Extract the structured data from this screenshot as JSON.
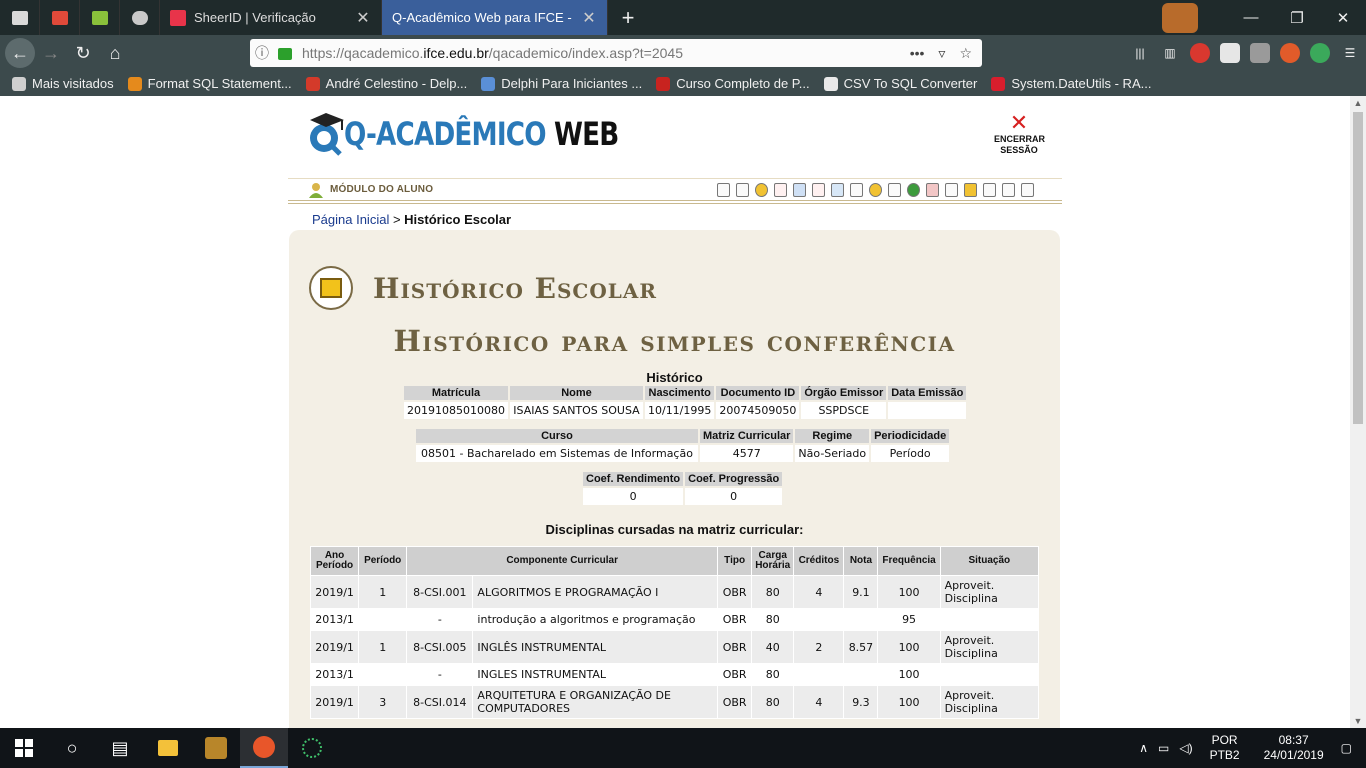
{
  "browser": {
    "tabs": [
      {
        "title": "SheerID | Verificação",
        "close": "✕"
      },
      {
        "title": "Q-Acadêmico Web para IFCE - Hist",
        "close": "✕"
      }
    ],
    "new_tab": "+",
    "url_prefix": "https://qacademico.",
    "url_domain": "ifce.edu.br",
    "url_path": "/qacademico/index.asp?t=2045",
    "bookmarks": [
      {
        "label": "Mais visitados",
        "color": "#cfcfcf"
      },
      {
        "label": "Format SQL Statement...",
        "color": "#e58a1c"
      },
      {
        "label": "André Celestino - Delp...",
        "color": "#d43a2a"
      },
      {
        "label": "Delphi Para Iniciantes ...",
        "color": "#5a8fd6"
      },
      {
        "label": "Curso Completo de P...",
        "color": "#c8231f"
      },
      {
        "label": "CSV To SQL Converter",
        "color": "#e9e9e9"
      },
      {
        "label": "System.DateUtils - RA...",
        "color": "#d81e2d"
      }
    ]
  },
  "header": {
    "logo_part1": "Q-ACADÊMICO",
    "logo_part2": " WEB",
    "logout_line1": "ENCERRAR",
    "logout_line2": "SESSÃO",
    "module_label": "MÓDULO DO ALUNO"
  },
  "breadcrumb": {
    "home": "Página Inicial",
    "separator": " > ",
    "current": "Histórico Escolar"
  },
  "page": {
    "title": "Histórico Escolar",
    "subtitle": "Histórico para simples conferência",
    "section_label": "Histórico",
    "disciplines_label": "Disciplinas cursadas na matriz curricular:"
  },
  "student": {
    "headers": [
      "Matrícula",
      "Nome",
      "Nascimento",
      "Documento ID",
      "Órgão Emissor",
      "Data Emissão"
    ],
    "values": [
      "20191085010080",
      "ISAIAS SANTOS SOUSA",
      "10/11/1995",
      "20074509050",
      "SSPDSCE",
      ""
    ]
  },
  "course": {
    "headers": [
      "Curso",
      "Matriz Curricular",
      "Regime",
      "Periodicidade"
    ],
    "values": [
      "08501 - Bacharelado em Sistemas de Informação",
      "4577",
      "Não-Seriado",
      "Período"
    ]
  },
  "coef": {
    "headers": [
      "Coef. Rendimento",
      "Coef. Progressão"
    ],
    "values": [
      "0",
      "0"
    ]
  },
  "disciplines": {
    "headers": [
      "Ano Período",
      "Período",
      "Componente Curricular",
      "Tipo",
      "Carga Horária",
      "Créditos",
      "Nota",
      "Frequência",
      "Situação"
    ],
    "rows": [
      {
        "ano": "2019/1",
        "periodo": "1",
        "codigo": "8-CSI.001",
        "nome": "ALGORITMOS E PROGRAMAÇÃO I",
        "tipo": "OBR",
        "carga": "80",
        "creditos": "4",
        "nota": "9.1",
        "freq": "100",
        "situacao": "Aproveit. Disciplina"
      },
      {
        "ano": "2013/1",
        "periodo": "",
        "codigo": "-",
        "nome": "introdução a algoritmos e programação",
        "tipo": "OBR",
        "carga": "80",
        "creditos": "",
        "nota": "",
        "freq": "95",
        "situacao": ""
      },
      {
        "ano": "2019/1",
        "periodo": "1",
        "codigo": "8-CSI.005",
        "nome": "INGLÊS INSTRUMENTAL",
        "tipo": "OBR",
        "carga": "40",
        "creditos": "2",
        "nota": "8.57",
        "freq": "100",
        "situacao": "Aproveit. Disciplina"
      },
      {
        "ano": "2013/1",
        "periodo": "",
        "codigo": "-",
        "nome": "INGLES INSTRUMENTAL",
        "tipo": "OBR",
        "carga": "80",
        "creditos": "",
        "nota": "",
        "freq": "100",
        "situacao": ""
      },
      {
        "ano": "2019/1",
        "periodo": "3",
        "codigo": "8-CSI.014",
        "nome": "ARQUITETURA E ORGANIZAÇÃO DE COMPUTADORES",
        "tipo": "OBR",
        "carga": "80",
        "creditos": "4",
        "nota": "9.3",
        "freq": "100",
        "situacao": "Aproveit. Disciplina"
      }
    ]
  },
  "taskbar": {
    "lang_line1": "POR",
    "lang_line2": "PTB2",
    "time": "08:37",
    "date": "24/01/2019"
  }
}
